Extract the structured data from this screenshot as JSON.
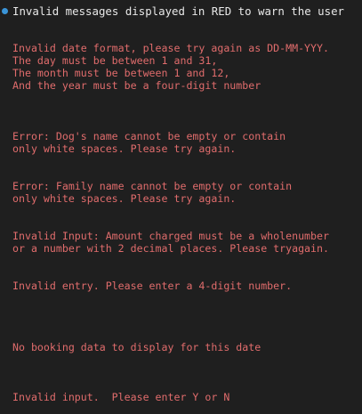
{
  "header": {
    "text": "Invalid messages displayed in RED to warn the user",
    "bullet_color": "#3a94d8",
    "text_color": "#e8e8e8"
  },
  "error_color": "#e06c6c",
  "messages": [
    {
      "text": "Invalid date format, please try again as DD-MM-YYY.\nThe day must be between 1 and 31,\nThe month must be between 1 and 12,\nAnd the year must be a four-digit number"
    },
    {
      "text": "Error: Dog's name cannot be empty or contain\nonly white spaces. Please try again."
    },
    {
      "text": "Error: Family name cannot be empty or contain\nonly white spaces. Please try again."
    },
    {
      "text": "Invalid Input: Amount charged must be a wholenumber\nor a number with 2 decimal places. Please tryagain."
    },
    {
      "text": "Invalid entry. Please enter a 4-digit number."
    },
    {
      "text": "No booking data to display for this date"
    },
    {
      "text": "Invalid input.  Please enter Y or N"
    }
  ]
}
